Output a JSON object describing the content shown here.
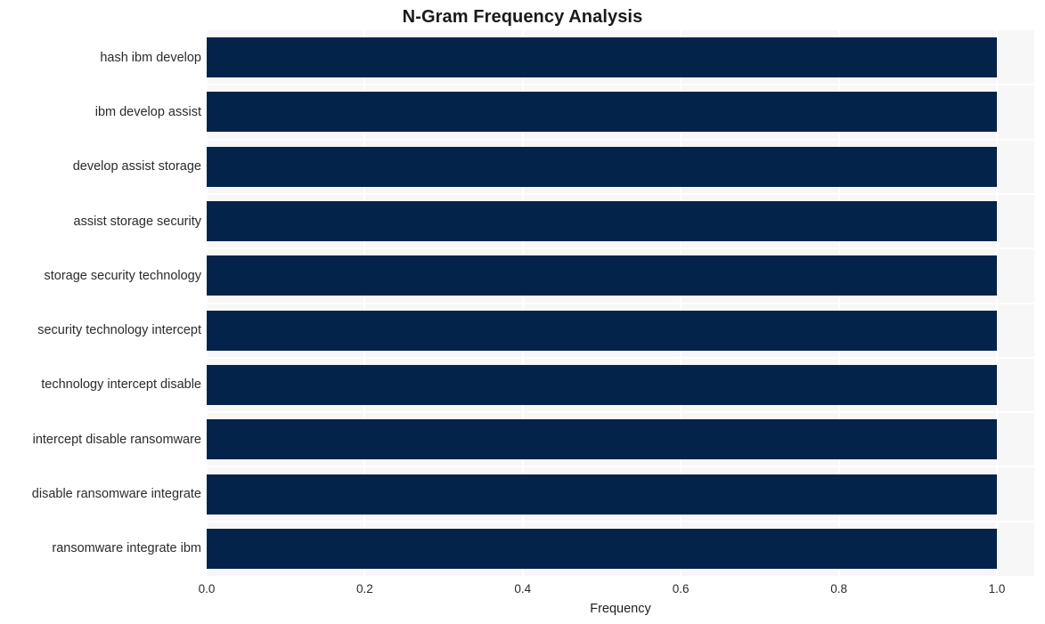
{
  "chart_data": {
    "type": "bar",
    "orientation": "horizontal",
    "title": "N-Gram Frequency Analysis",
    "xlabel": "Frequency",
    "ylabel": "",
    "categories": [
      "hash ibm develop",
      "ibm develop assist",
      "develop assist storage",
      "assist storage security",
      "storage security technology",
      "security technology intercept",
      "technology intercept disable",
      "intercept disable ransomware",
      "disable ransomware integrate",
      "ransomware integrate ibm"
    ],
    "values": [
      1.0,
      1.0,
      1.0,
      1.0,
      1.0,
      1.0,
      1.0,
      1.0,
      1.0,
      1.0
    ],
    "xlim": [
      0.0,
      1.0
    ],
    "xticks": [
      "0.0",
      "0.2",
      "0.4",
      "0.6",
      "0.8",
      "1.0"
    ],
    "xtick_values": [
      0.0,
      0.2,
      0.4,
      0.6,
      0.8,
      1.0
    ],
    "grid": "vertical-and-horizontal-white-on-light-gray",
    "legend": "none",
    "bar_color": "#03234b",
    "plot_background": "#f7f7f7",
    "figure_background": "#ffffff",
    "text_color": "#2b2b2b"
  }
}
